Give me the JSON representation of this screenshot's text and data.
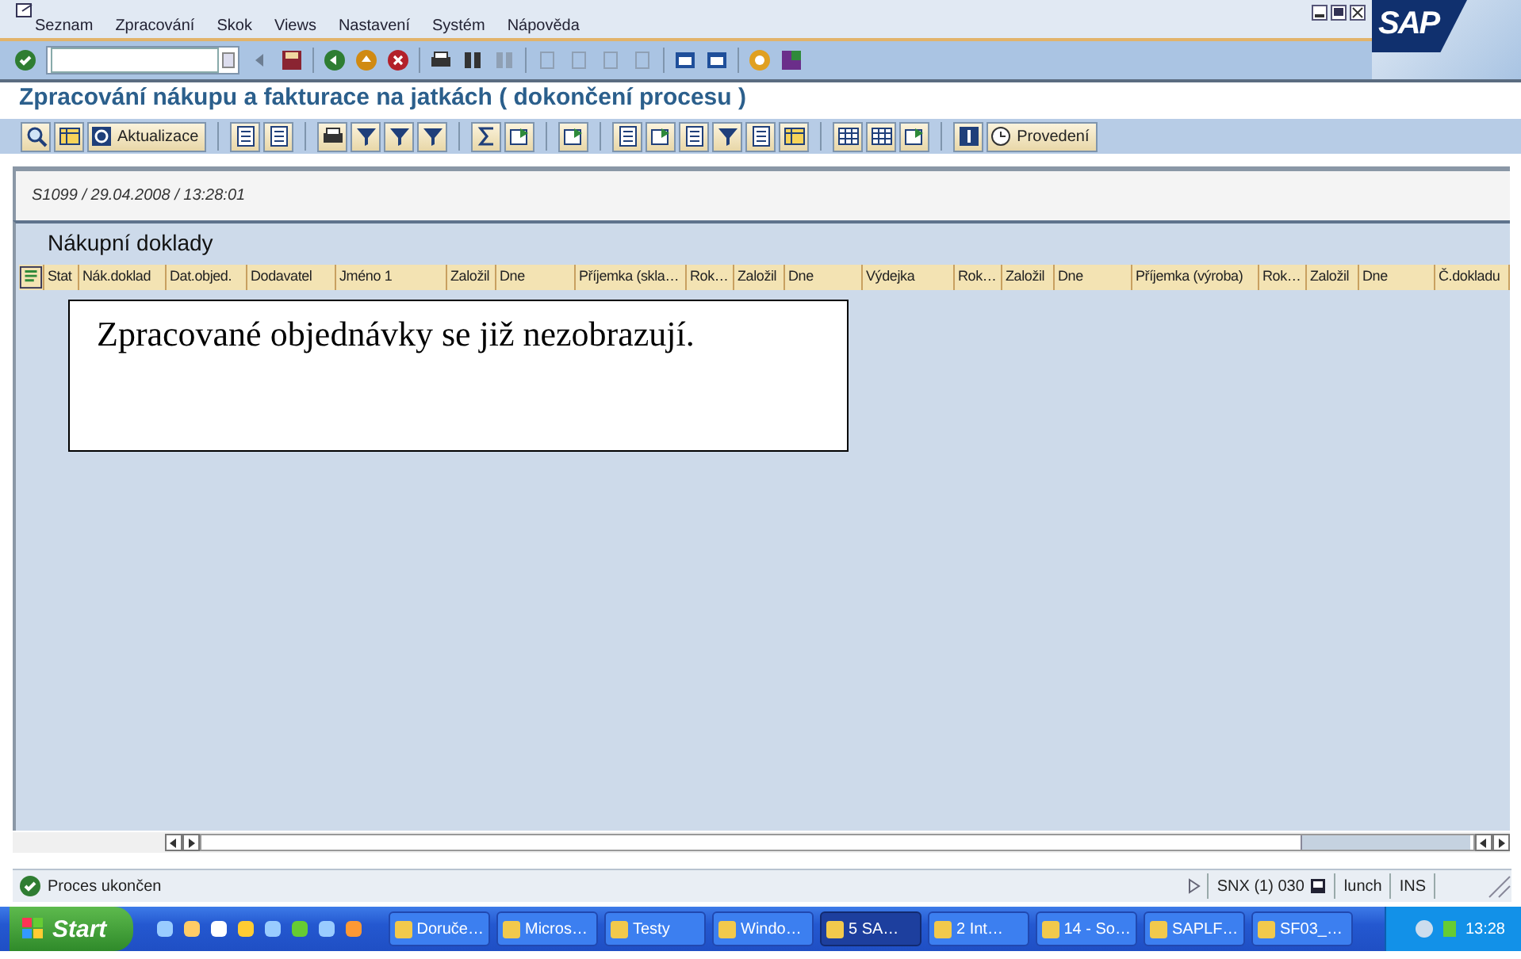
{
  "logo": "SAP",
  "menu": [
    "Seznam",
    "Zpracování",
    "Skok",
    "Views",
    "Nastavení",
    "Systém",
    "Nápověda"
  ],
  "title": "Zpracování nákupu a fakturace na jatkách ( dokončení procesu )",
  "app_toolbar": {
    "buttons": [
      {
        "label": "Aktualizace"
      },
      {
        "label": "Provedení"
      }
    ]
  },
  "header_info": "S1099 / 29.04.2008 / 13:28:01",
  "grid": {
    "title": "Nákupní doklady",
    "columns": [
      "Stat",
      "Nák.doklad",
      "Dat.objed.",
      "Dodavatel",
      "Jméno 1",
      "Založil",
      "Dne",
      "Příjemka (skla…",
      "Rok…",
      "Založil",
      "Dne",
      "Výdejka",
      "Rok…",
      "Založil",
      "Dne",
      "Příjemka (výroba)",
      "Rok…",
      "Založil",
      "Dne",
      "Č.dokladu"
    ]
  },
  "note": "Zpracované objednávky se již nezobrazují.",
  "status_bar": {
    "message": "Proces ukončen",
    "system": "SNX (1) 030",
    "server": "lunch",
    "mode": "INS"
  },
  "taskbar": {
    "start": "Start",
    "clock": "13:28",
    "tasks": [
      {
        "label": "Doruče…",
        "selected": false
      },
      {
        "label": "Micros…",
        "selected": false
      },
      {
        "label": "Testy",
        "selected": false
      },
      {
        "label": "Windo…",
        "selected": false
      },
      {
        "label": "5 SA…",
        "selected": true
      },
      {
        "label": "2 Int…",
        "selected": false
      },
      {
        "label": "14 - So…",
        "selected": false
      },
      {
        "label": "SAPLF…",
        "selected": false
      },
      {
        "label": "SF03_…",
        "selected": false
      }
    ]
  }
}
